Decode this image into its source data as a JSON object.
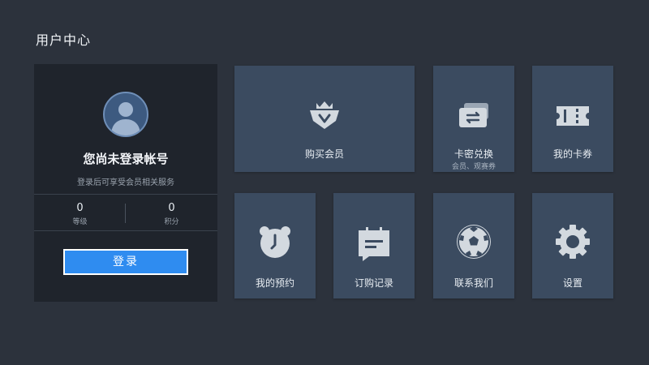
{
  "page": {
    "title": "用户中心"
  },
  "user_card": {
    "title": "您尚未登录帐号",
    "subtitle": "登录后可享受会员相关服务",
    "level_value": "0",
    "level_label": "等级",
    "points_value": "0",
    "points_label": "积分",
    "login_label": "登录",
    "avatar_icon": "user-avatar-icon"
  },
  "tiles": {
    "buy_vip": {
      "label": "购买会员",
      "icon": "vip-badge-icon"
    },
    "card_redeem": {
      "label": "卡密兑换",
      "sub": "会员、观赛券",
      "icon": "card-exchange-icon"
    },
    "my_coupons": {
      "label": "我的卡券",
      "icon": "ticket-icon"
    },
    "my_reservations": {
      "label": "我的预约",
      "icon": "alarm-clock-icon"
    },
    "order_history": {
      "label": "订购记录",
      "icon": "message-card-icon"
    },
    "contact_us": {
      "label": "联系我们",
      "icon": "soccer-ball-icon"
    },
    "settings": {
      "label": "设置",
      "icon": "gear-icon"
    }
  },
  "colors": {
    "background": "#2c323c",
    "card_bg": "#1f242c",
    "tile_bg": "#3b4b60",
    "accent": "#2f8cf0"
  }
}
